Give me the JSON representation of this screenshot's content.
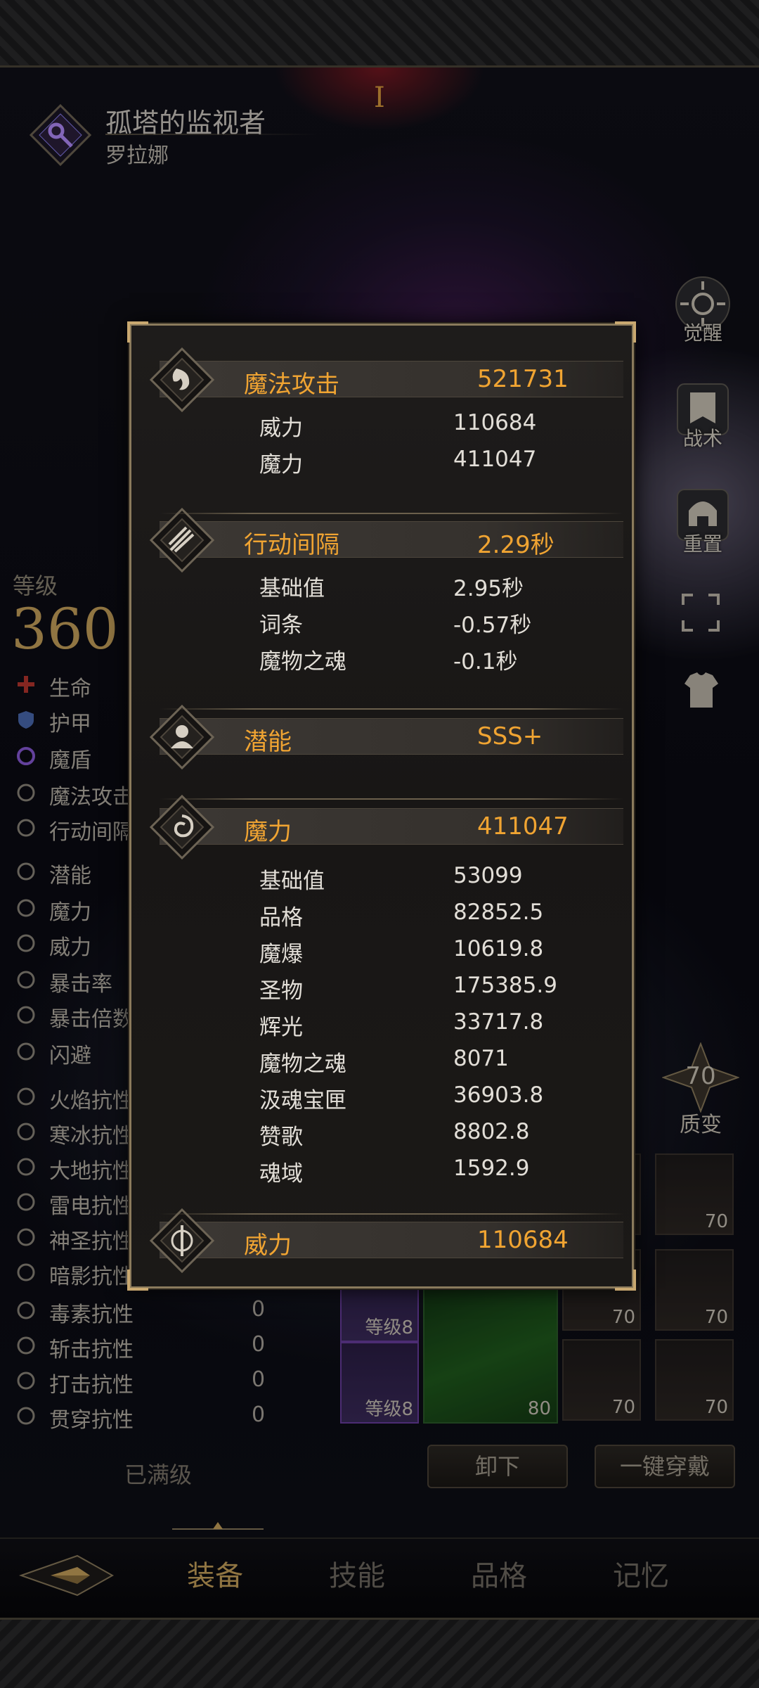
{
  "header": {
    "title": "孤塔的监视者",
    "subtitle": "罗拉娜"
  },
  "side_buttons": [
    {
      "label": "觉醒",
      "icon": "awaken-sun-icon"
    },
    {
      "label": "战术",
      "icon": "tactics-banner-icon"
    },
    {
      "label": "重置",
      "icon": "reset-helmet-icon"
    }
  ],
  "quality": {
    "value": "70",
    "label": "质变"
  },
  "level": {
    "label": "等级",
    "value": "360"
  },
  "stats": [
    {
      "name": "生命",
      "value": ""
    },
    {
      "name": "护甲",
      "value": ""
    },
    {
      "name": "魔盾",
      "value": ""
    },
    {
      "name": "魔法攻击",
      "value": ""
    },
    {
      "name": "行动间隔",
      "value": ""
    },
    {
      "name": "潜能",
      "value": ""
    },
    {
      "name": "魔力",
      "value": ""
    },
    {
      "name": "威力",
      "value": ""
    },
    {
      "name": "暴击率",
      "value": ""
    },
    {
      "name": "暴击倍数",
      "value": ""
    },
    {
      "name": "闪避",
      "value": ""
    },
    {
      "name": "火焰抗性",
      "value": ""
    },
    {
      "name": "寒冰抗性",
      "value": ""
    },
    {
      "name": "大地抗性",
      "value": ""
    },
    {
      "name": "雷电抗性",
      "value": ""
    },
    {
      "name": "神圣抗性",
      "value": ""
    },
    {
      "name": "暗影抗性",
      "value": ""
    },
    {
      "name": "毒素抗性",
      "value": "0"
    },
    {
      "name": "斩击抗性",
      "value": "0"
    },
    {
      "name": "打击抗性",
      "value": "0"
    },
    {
      "name": "贯穿抗性",
      "value": "0"
    }
  ],
  "maxed_label": "已满级",
  "equipment": {
    "slot_levels": [
      "70",
      "70",
      "70",
      "70",
      "70",
      "80"
    ],
    "purple_slots": [
      "等级8",
      "等级8"
    ],
    "partial_level": "0"
  },
  "actions": {
    "unequip": "卸下",
    "equip_all": "一键穿戴"
  },
  "nav": {
    "tabs": [
      "装备",
      "技能",
      "品格",
      "记忆"
    ],
    "active": "装备"
  },
  "tooltip": {
    "sections": [
      {
        "name": "魔法攻击",
        "value": "521731",
        "icon": "magic-attack-icon",
        "rows": [
          {
            "name": "威力",
            "value": "110684"
          },
          {
            "name": "魔力",
            "value": "411047"
          }
        ]
      },
      {
        "name": "行动间隔",
        "value": "2.29秒",
        "icon": "action-interval-icon",
        "rows": [
          {
            "name": "基础值",
            "value": "2.95秒"
          },
          {
            "name": "词条",
            "value": "-0.57秒"
          },
          {
            "name": "魔物之魂",
            "value": "-0.1秒"
          }
        ]
      },
      {
        "name": "潜能",
        "value": "SSS+",
        "icon": "potential-bust-icon",
        "rows": []
      },
      {
        "name": "魔力",
        "value": "411047",
        "icon": "magic-power-swirl-icon",
        "rows": [
          {
            "name": "基础值",
            "value": "53099"
          },
          {
            "name": "品格",
            "value": "82852.5"
          },
          {
            "name": "魔爆",
            "value": "10619.8"
          },
          {
            "name": "圣物",
            "value": "175385.9"
          },
          {
            "name": "辉光",
            "value": "33717.8"
          },
          {
            "name": "魔物之魂",
            "value": "8071"
          },
          {
            "name": "汲魂宝匣",
            "value": "36903.8"
          },
          {
            "name": "赞歌",
            "value": "8802.8"
          },
          {
            "name": "魂域",
            "value": "1592.9"
          }
        ]
      },
      {
        "name": "威力",
        "value": "110684",
        "icon": "might-sword-icon",
        "rows": []
      }
    ]
  },
  "colors": {
    "accent": "#f0a432",
    "gold": "#c8a25c",
    "border": "#8a7a5c"
  }
}
